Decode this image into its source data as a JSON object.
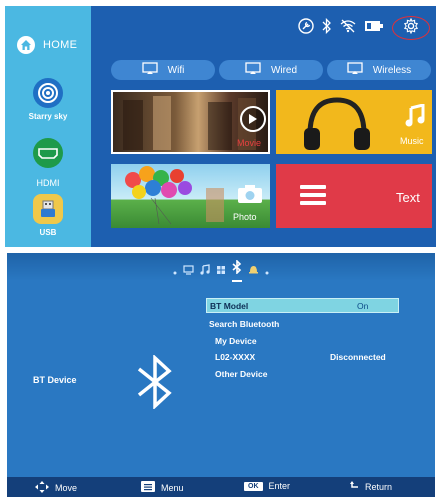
{
  "launcher": {
    "home_label": "HOME",
    "sidebar": [
      {
        "label": "Starry sky",
        "icon": "starry-sky-icon"
      },
      {
        "label": "HDMI",
        "icon": "hdmi-icon"
      },
      {
        "label": "USB",
        "icon": "usb-icon"
      }
    ],
    "status_icons": [
      "tools-icon",
      "bluetooth-icon",
      "wifi-off-icon",
      "battery-icon",
      "gear-icon"
    ],
    "network_buttons": [
      "Wifi",
      "Wired",
      "Wireless"
    ],
    "tiles": {
      "movie": "Movie",
      "music": "Music",
      "photo": "Photo",
      "text": "Text"
    },
    "colors": {
      "sidebar": "#4bb8e2",
      "main": "#1d5fb0",
      "music_tile": "#f2b81c",
      "text_tile": "#e03a48",
      "gear_highlight": "#e0303a"
    }
  },
  "bt_menu": {
    "top_icons": [
      "dot-icon",
      "monitor-icon",
      "music-note-icon",
      "grid-icon",
      "bluetooth-icon",
      "bell-icon",
      "dot-icon"
    ],
    "left_label": "BT Device",
    "items": [
      {
        "label": "BT Model",
        "value": "On"
      },
      {
        "label": "Search Bluetooth"
      },
      {
        "label": "My Device"
      },
      {
        "label": "L02-XXXX",
        "value": "Disconnected"
      },
      {
        "label": "Other Device"
      }
    ],
    "footer": {
      "move": "Move",
      "menu": "Menu",
      "ok_badge": "OK",
      "enter": "Enter",
      "return": "Return"
    },
    "colors": {
      "background": "#2a78c2",
      "footer": "#143f7a",
      "highlight": "#7fd4e2"
    }
  }
}
